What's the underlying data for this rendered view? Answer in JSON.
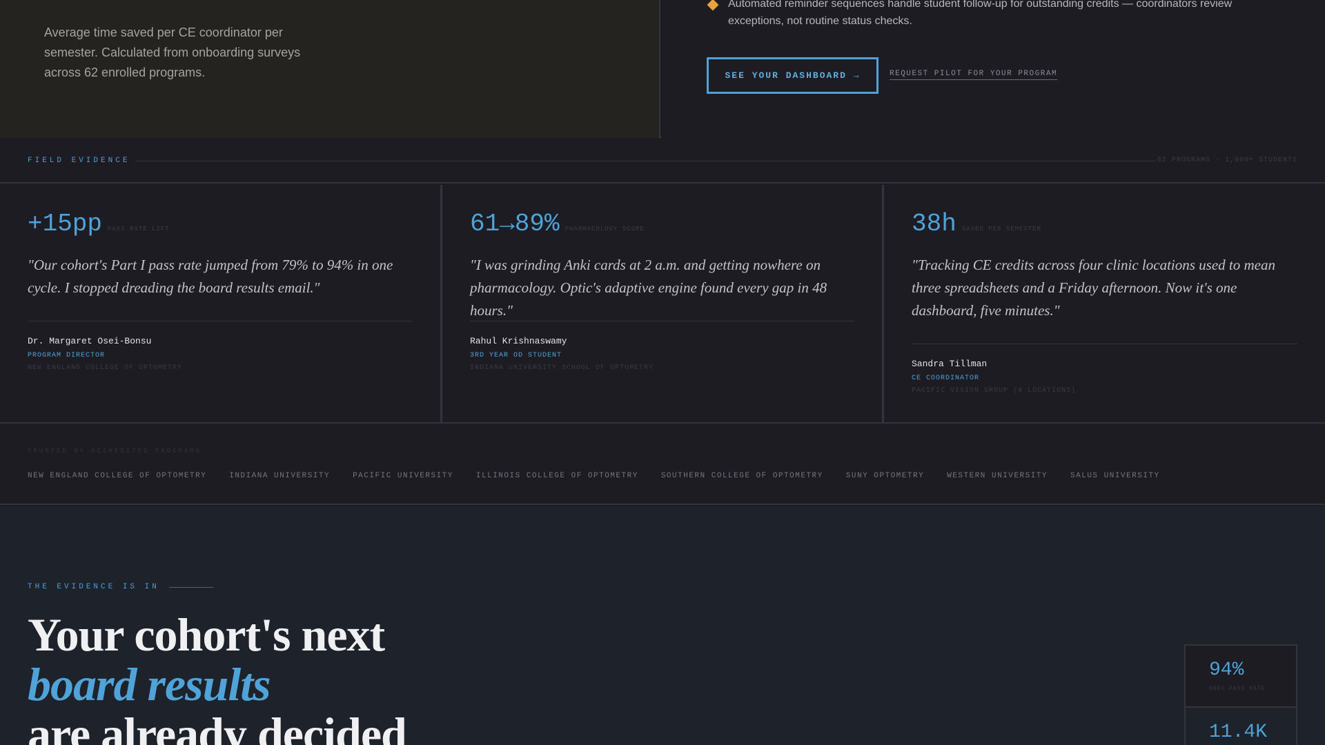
{
  "top": {
    "left_text": "Average time saved per CE coordinator per semester. Calculated from onboarding surveys across 62 enrolled programs.",
    "bullet_text": "Automated reminder sequences handle student follow-up for outstanding credits — coordinators review exceptions, not routine status checks.",
    "cta_primary": "SEE YOUR DASHBOARD →",
    "cta_secondary": "REQUEST PILOT FOR YOUR PROGRAM"
  },
  "field_evidence": {
    "label": "FIELD EVIDENCE",
    "meta": "62 PROGRAMS · 1,000+ STUDENTS"
  },
  "testimonials": [
    {
      "stat_value": "+15pp",
      "stat_label": "PASS RATE LIFT",
      "quote": "\"Our cohort's Part I pass rate jumped from 79% to 94% in one cycle. I stopped dreading the board results email.\"",
      "name": "Dr. Margaret Osei-Bonsu",
      "role": "PROGRAM DIRECTOR",
      "org": "NEW ENGLAND COLLEGE OF OPTOMETRY"
    },
    {
      "stat_value": "61→89%",
      "stat_label": "PHARMACOLOGY SCORE",
      "quote": "\"I was grinding Anki cards at 2 a.m. and getting nowhere on pharmacology. Optic's adaptive engine found every gap in 48 hours.\"",
      "name": "Rahul Krishnaswamy",
      "role": "3RD YEAR OD STUDENT",
      "org": "INDIANA UNIVERSITY SCHOOL OF OPTOMETRY"
    },
    {
      "stat_value": "38h",
      "stat_label": "SAVED PER SEMESTER",
      "quote": "\"Tracking CE credits across four clinic locations used to mean three spreadsheets and a Friday afternoon. Now it's one dashboard, five minutes.\"",
      "name": "Sandra Tillman",
      "role": "CE COORDINATOR",
      "org": "PACIFIC VISION GROUP (4 LOCATIONS)"
    }
  ],
  "trusted": {
    "label": "TRUSTED BY ACCREDITED PROGRAMS",
    "items": [
      "NEW ENGLAND COLLEGE OF OPTOMETRY",
      "INDIANA UNIVERSITY",
      "PACIFIC UNIVERSITY",
      "ILLINOIS COLLEGE OF OPTOMETRY",
      "SOUTHERN COLLEGE OF OPTOMETRY",
      "SUNY OPTOMETRY",
      "WESTERN UNIVERSITY",
      "SALUS UNIVERSITY"
    ]
  },
  "evidence": {
    "label": "THE EVIDENCE IS IN",
    "headline_1": "Your cohort's next",
    "headline_accent": "board results",
    "headline_3": "are already decided",
    "stats": [
      {
        "value": "94%",
        "label": "NBEO PASS RATE"
      },
      {
        "value": "11.4K",
        "label": ""
      }
    ]
  },
  "colors": {
    "accent": "#4fa3d8",
    "bullet": "#e8a33c",
    "background": "#1d1c22"
  }
}
